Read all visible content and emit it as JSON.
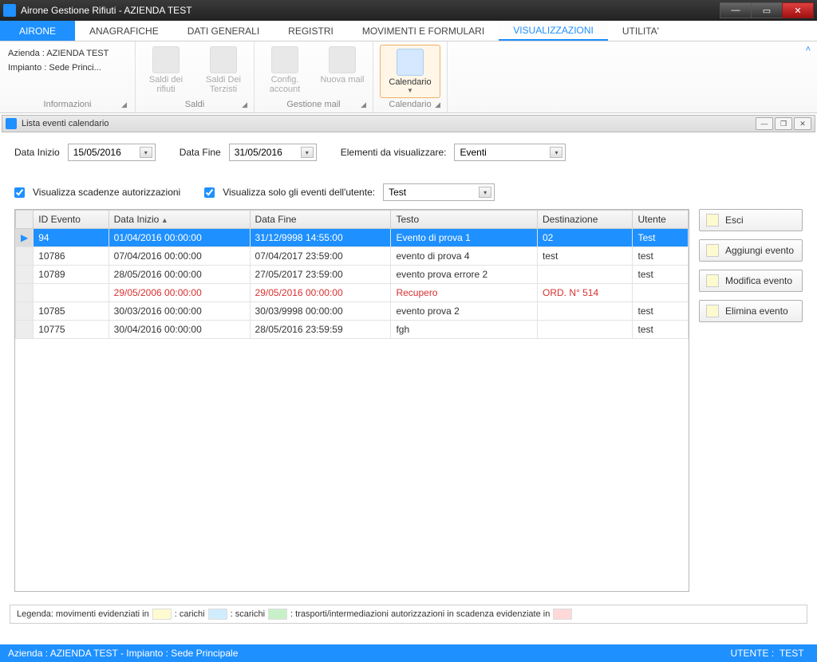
{
  "window": {
    "title": "Airone Gestione Rifiuti - AZIENDA TEST"
  },
  "ribbonTabs": {
    "app": "AIRONE",
    "anagrafiche": "ANAGRAFICHE",
    "datiGenerali": "DATI GENERALI",
    "registri": "REGISTRI",
    "movimenti": "MOVIMENTI E FORMULARI",
    "visualizzazioni": "VISUALIZZAZIONI",
    "utilita": "UTILITA'"
  },
  "ribbon": {
    "info": {
      "azienda": "Azienda : AZIENDA TEST",
      "impianto": "Impianto : Sede Princi...",
      "group": "Informazioni"
    },
    "saldi": {
      "saldiRifiuti": "Saldi dei rifiuti",
      "saldiTerzisti": "Saldi Dei Terzisti",
      "group": "Saldi"
    },
    "mail": {
      "config": "Config. account",
      "nuova": "Nuova mail",
      "group": "Gestione mail"
    },
    "calendario": {
      "btn": "Calendario",
      "group": "Calendario"
    }
  },
  "childWindow": {
    "title": "Lista eventi calendario"
  },
  "filters": {
    "dataInizioLabel": "Data Inizio",
    "dataInizio": "15/05/2016",
    "dataFineLabel": "Data Fine",
    "dataFine": "31/05/2016",
    "elementiLabel": "Elementi da visualizzare:",
    "elementi": "Eventi",
    "chkScadenze": "Visualizza scadenze autorizzazioni",
    "chkUtente": "Visualizza solo gli eventi dell'utente:",
    "utente": "Test"
  },
  "grid": {
    "headers": {
      "id": "ID Evento",
      "dataInizio": "Data Inizio",
      "dataFine": "Data Fine",
      "testo": "Testo",
      "dest": "Destinazione",
      "utente": "Utente"
    },
    "rows": [
      {
        "sel": true,
        "id": "94",
        "di": "01/04/2016 00:00:00",
        "df": "31/12/9998 14:55:00",
        "testo": "Evento di prova 1",
        "dest": "02",
        "utente": "Test"
      },
      {
        "sel": false,
        "id": "10786",
        "di": "07/04/2016 00:00:00",
        "df": "07/04/2017 23:59:00",
        "testo": "evento di prova 4",
        "dest": "test",
        "utente": "test"
      },
      {
        "sel": false,
        "id": "10789",
        "di": "28/05/2016 00:00:00",
        "df": "27/05/2017 23:59:00",
        "testo": "evento prova errore 2",
        "dest": "",
        "utente": "test"
      },
      {
        "sel": false,
        "warn": true,
        "id": "",
        "di": "29/05/2006 00:00:00",
        "df": "29/05/2016 00:00:00",
        "testo": "Recupero",
        "dest": "ORD. N° 514",
        "utente": ""
      },
      {
        "sel": false,
        "id": "10785",
        "di": "30/03/2016 00:00:00",
        "df": "30/03/9998 00:00:00",
        "testo": "evento prova 2",
        "dest": "",
        "utente": "test"
      },
      {
        "sel": false,
        "id": "10775",
        "di": "30/04/2016 00:00:00",
        "df": "28/05/2016 23:59:59",
        "testo": "fgh",
        "dest": "",
        "utente": "test"
      }
    ]
  },
  "sideButtons": {
    "esci": "Esci",
    "aggiungi": "Aggiungi evento",
    "modifica": "Modifica evento",
    "elimina": "Elimina evento"
  },
  "legend": {
    "prefix": "Legenda: movimenti evidenziati in",
    "carichi": ": carichi",
    "scarichi": ": scarichi",
    "trasporti": ": trasporti/intermediazioni  autorizzazioni in scadenza evidenziate in"
  },
  "status": {
    "left": "Azienda : AZIENDA TEST - Impianto : Sede Principale",
    "rightLabel": "UTENTE :",
    "rightValue": "TEST"
  }
}
